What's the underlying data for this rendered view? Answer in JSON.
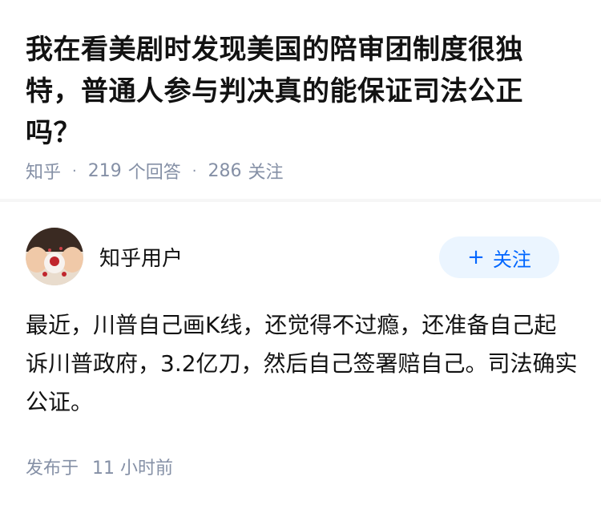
{
  "question": {
    "title": "我在看美剧时发现美国的陪审团制度很独特，普通人参与判决真的能保证司法公正吗？",
    "source": "知乎",
    "separator": "·",
    "answer_count": "219",
    "answer_count_label": "个回答",
    "follow_count": "286",
    "follow_count_label": "关注"
  },
  "answer": {
    "author_name": "知乎用户",
    "follow_button": {
      "icon": "+",
      "label": "关注"
    },
    "content": "最近，川普自己画K线，还觉得不过瘾，还准备自己起诉川普政府，3.2亿刀，然后自己签署赔自己。司法确实公证。",
    "published_label": "发布于",
    "published_time": "11 小时前"
  },
  "colors": {
    "text_primary": "#121212",
    "text_secondary": "#8590a6",
    "accent": "#0066ff",
    "button_bg": "#ebf5ff"
  }
}
